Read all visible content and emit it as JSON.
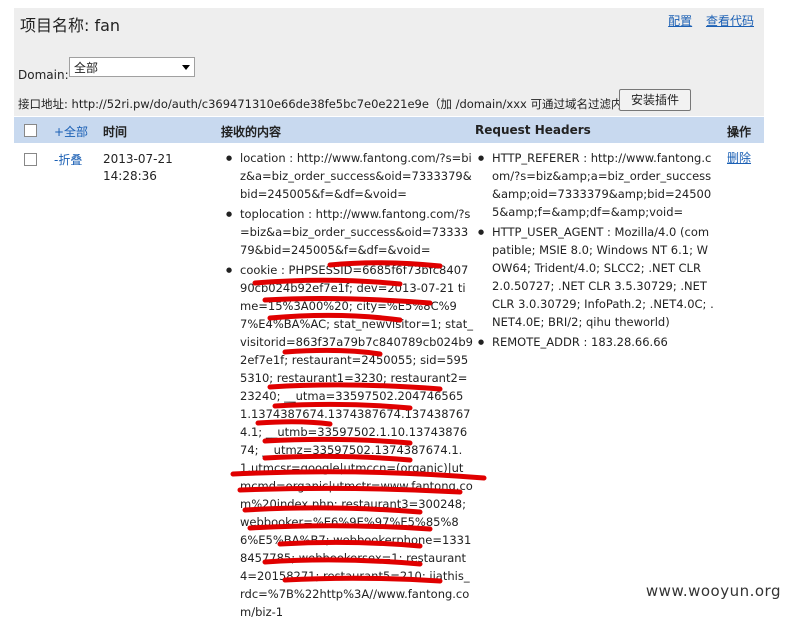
{
  "header": {
    "title": "项目名称: fan",
    "config_link": "配置",
    "view_code_link": "查看代码",
    "domain_label": "Domain:",
    "domain_selected": "全部",
    "api_text": "接口地址: http://52ri.pw/do/auth/c369471310e66de38fe5bc7e0e221e9e（加 /domain/xxx 可通过域名过滤内容）",
    "install_button": "安装插件"
  },
  "table": {
    "col_all": "+全部",
    "col_time": "时间",
    "col_content": "接收的内容",
    "col_headers": "Request Headers",
    "col_action": "操作"
  },
  "row": {
    "fold": "-折叠",
    "date": "2013-07-21",
    "clock": "14:28:36",
    "delete": "删除",
    "content": [
      "location : http://www.fantong.com/?s=biz&a=biz_order_success&oid=7333379&bid=245005&f=&df=&void=",
      "toplocation : http://www.fantong.com/?s=biz&a=biz_order_success&oid=7333379&bid=245005&f=&df=&void=",
      "cookie : PHPSESSID=6685f6f73bfc840790cb024b92ef7e1f; dev=2013-07-21 time=15%3A00%20; city=%E5%8C%97%E4%BA%AC; stat_newvisitor=1; stat_visitorid=863f37a79b7c840789cb024b92ef7e1f; restaurant=2450055; sid=5955310; restaurant1=3230; restaurant2=23240; __utma=33597502.2047465651.1374387674.1374387674.1374387674.1; __utmb=33597502.1.10.1374387674; __utmz=33597502.1374387674.1.1.utmcsr=google|utmccn=(organic)|utmcmd=organic|utmctr=www.fantong.com%20index.php; restaurant3=300248; webbooker=%E6%9E%97%E5%85%86%E5%BA%B7; webbookerphone=13318457785; webbookersex=1; restaurant4=20158271; restaurant5=210; jiathis_rdc=%7B%22http%3A//www.fantong.com/biz-1"
    ],
    "headers": [
      "HTTP_REFERER : http://www.fantong.com/?s=biz&amp;a=biz_order_success&amp;oid=7333379&amp;bid=245005&amp;f=&amp;df=&amp;void=",
      "HTTP_USER_AGENT : Mozilla/4.0 (compatible; MSIE 8.0; Windows NT 6.1; WOW64; Trident/4.0; SLCC2; .NET CLR 2.0.50727; .NET CLR 3.5.30729; .NET CLR 3.0.30729; InfoPath.2; .NET4.0C; .NET4.0E; BRI/2; qihu theworld)",
      "REMOTE_ADDR : 183.28.66.66"
    ]
  },
  "watermark": "www.wooyun.org",
  "colors": {
    "header_bg": "#eeeeee",
    "table_head_bg": "#c8d9ef",
    "link": "#1a5fb4",
    "redact": "#e00000"
  }
}
